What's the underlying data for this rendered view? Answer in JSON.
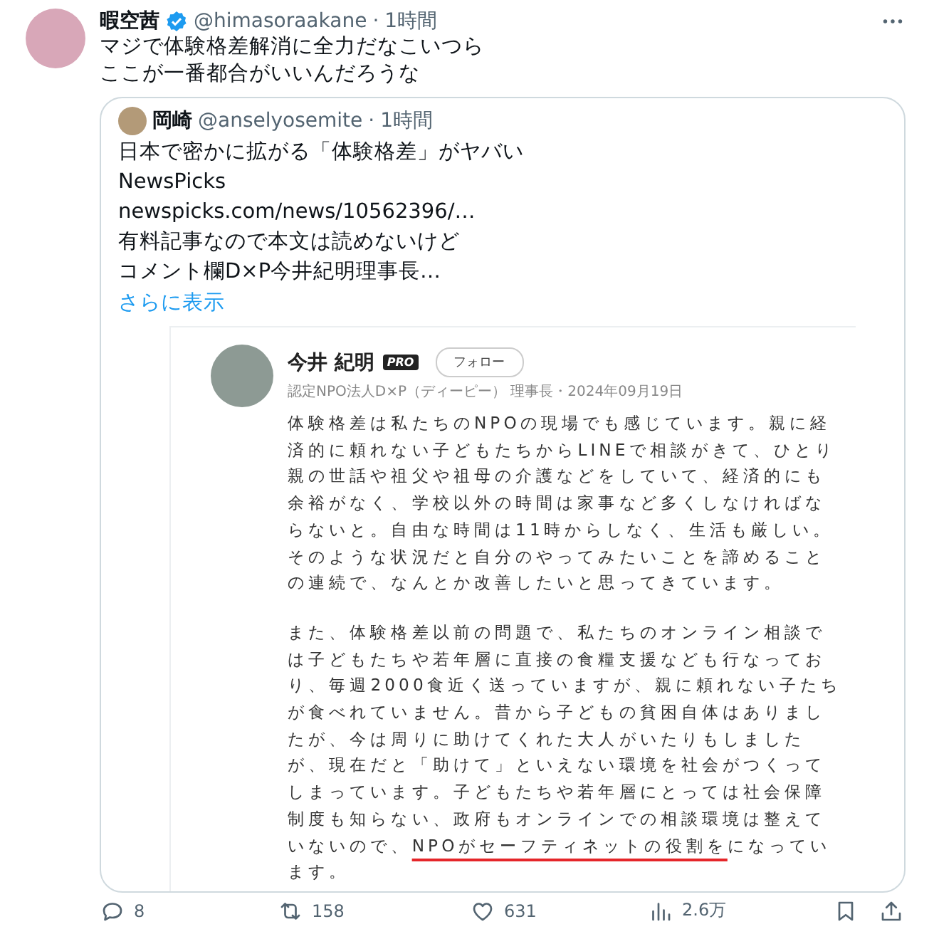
{
  "post": {
    "author": "暇空茜",
    "handle": "@himasoraakane",
    "separator": "·",
    "time": "1時間",
    "lines": [
      "マジで体験格差解消に全力だなこいつら",
      "ここが一番都合がいいんだろうな"
    ]
  },
  "quote": {
    "author": "岡崎",
    "handle": "@anselyosemite",
    "separator": "·",
    "time": "1時間",
    "lines": [
      "日本で密かに拡がる「体験格差」がヤバい",
      "NewsPicks",
      "newspicks.com/news/10562396/…",
      "有料記事なので本文は読めないけど",
      "コメント欄D×P今井紀明理事長…"
    ],
    "show_more": "さらに表示",
    "screenshot": {
      "author": "今井 紀明",
      "badge": "PRO",
      "follow": "フォロー",
      "subtitle": "認定NPO法人D×P（ディーピー） 理事長・2024年09月19日",
      "paragraphs": [
        [
          [
            {
              "text": "体験格差は私たちのNPOの現場でも感じています。親に経"
            }
          ],
          [
            {
              "text": "済的に頼れない子どもたちからLINEで相談がきて、ひとり"
            }
          ],
          [
            {
              "text": "親の世話や祖父や祖母の介護などをしていて、経済的にも"
            }
          ],
          [
            {
              "text": "余裕がなく、学校以外の時間は家事など多くしなければな"
            }
          ],
          [
            {
              "text": "らないと。自由な時間は11時からしなく、生活も厳しい。"
            }
          ],
          [
            {
              "text": "そのような状況だと自分のやってみたいことを諦めること"
            }
          ],
          [
            {
              "text": "の連続で、なんとか改善したいと思ってきています。"
            }
          ]
        ],
        [
          [
            {
              "text": "また、体験格差以前の問題で、私たちのオンライン相談で"
            }
          ],
          [
            {
              "text": "は子どもたちや若年層に直接の食糧支援なども行なってお"
            }
          ],
          [
            {
              "text": "り、毎週2000食近く送っていますが、親に頼れない子たち"
            }
          ],
          [
            {
              "text": "が食べれていません。昔から子どもの貧困自体はありまし"
            }
          ],
          [
            {
              "text": "たが、今は周りに助けてくれた大人がいたりもしました"
            }
          ],
          [
            {
              "text": "が、現在だと「助けて」といえない環境を社会がつくって"
            }
          ],
          [
            {
              "text": "しまっています。子どもたちや若年層にとっては社会保障"
            }
          ],
          [
            {
              "text": "制度も知らない、政府もオンラインでの相談環境は整えて"
            }
          ],
          [
            {
              "text": "いないので、"
            },
            {
              "text": "NPOがセーフティネットの役割を",
              "underlined": true
            },
            {
              "text": "になってい"
            }
          ],
          [
            {
              "text": "ます。"
            }
          ]
        ]
      ]
    }
  },
  "actions": {
    "replies": "8",
    "reposts": "158",
    "likes": "631",
    "views": "2.6万"
  }
}
